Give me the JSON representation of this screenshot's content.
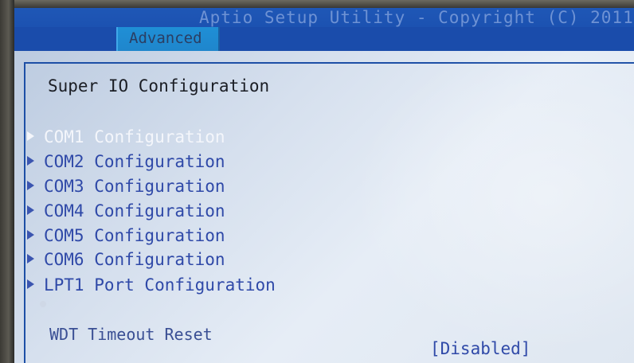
{
  "header": {
    "title": "Aptio Setup Utility - Copyright (C) 2011"
  },
  "tabs": [
    {
      "label": "Advanced",
      "active": true
    }
  ],
  "page": {
    "title": "Super IO Configuration"
  },
  "menu": {
    "items": [
      {
        "label": "COM1 Configuration",
        "icon": "submenu-arrow-icon",
        "selected": true
      },
      {
        "label": "COM2 Configuration",
        "icon": "submenu-arrow-icon"
      },
      {
        "label": "COM3 Configuration",
        "icon": "submenu-arrow-icon"
      },
      {
        "label": "COM4 Configuration",
        "icon": "submenu-arrow-icon"
      },
      {
        "label": "COM5 Configuration",
        "icon": "submenu-arrow-icon"
      },
      {
        "label": "COM6 Configuration",
        "icon": "submenu-arrow-icon"
      },
      {
        "label": "LPT1 Port Configuration",
        "icon": "submenu-arrow-icon"
      }
    ]
  },
  "settings": {
    "wdt_timeout_reset": {
      "label": "WDT Timeout Reset",
      "value": "[Disabled]"
    }
  },
  "colors": {
    "header_bg": "#1a4fae",
    "active_tab_bg": "#1f8fd6",
    "content_bg": "#d6e0ee",
    "menu_text": "#2f49a8",
    "selected_text": "#f4f6fb"
  }
}
